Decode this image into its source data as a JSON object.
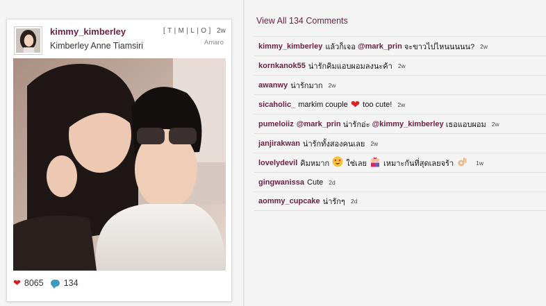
{
  "post": {
    "username": "kimmy_kimberley",
    "full_name": "Kimberley Anne Tiamsiri",
    "tmlo": [
      "T",
      "M",
      "L",
      "O"
    ],
    "age": "2w",
    "filter": "Amaro",
    "likes": "8065",
    "comment_count": "134"
  },
  "comments_header": {
    "view_all": "View All 134 Comments"
  },
  "comments": [
    {
      "user": "kimmy_kimberley",
      "text": "แล้วก็เจอ",
      "mention": "@mark_prin",
      "text2": "จะขาวไปไหนนนนน?",
      "time": "2w"
    },
    {
      "user": "kornkanok55",
      "text": "น่ารักคิมแอบผอมลงนะค้า",
      "time": "2w"
    },
    {
      "user": "awanwy",
      "text": "น่ารักมาก",
      "time": "2w"
    },
    {
      "user": "sicaholic_",
      "text": "markim couple",
      "emoji": "heart-icon",
      "text2": "too cute!",
      "time": "2w"
    },
    {
      "user": "pumeloiiz",
      "mention": "@mark_prin",
      "text": "น่ารักอ่ะ",
      "mention2": "@kimmy_kimberley",
      "text2": "เธอแอบผอม",
      "time": "2w"
    },
    {
      "user": "janjirakwan",
      "text": "น่ารักทั้งสองคนเลย",
      "time": "2w"
    },
    {
      "user": "lovelydevil",
      "text": "คิมหมาก",
      "emoji": "heart-eyes-icon",
      "text2": "ใช่เลย",
      "emoji2": "couple-kiss-icon",
      "text3": "เหมาะกันที่สุดเลยจร้า",
      "emoji3": "ok-hand-icon",
      "time": "1w"
    },
    {
      "user": "gingwanissa",
      "text": "Cute",
      "time": "2d"
    },
    {
      "user": "aommy_cupcake",
      "text": "น่ารักๆ",
      "time": "2d"
    }
  ],
  "colors": {
    "username": "#6b1f44",
    "heart": "#cc2222",
    "comment_bubble": "#3f9ac0"
  }
}
